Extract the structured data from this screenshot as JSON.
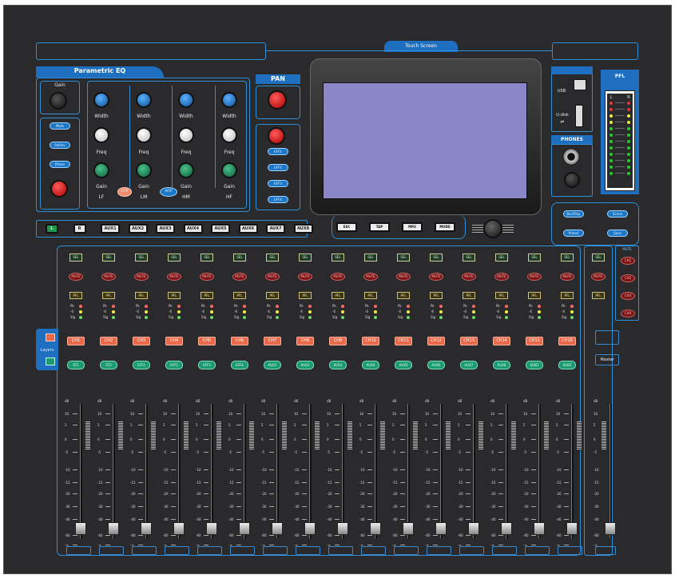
{
  "touch_screen_label": "Touch Screen",
  "eq": {
    "title": "Parametric EQ",
    "gain_label": "Gain",
    "side_buttons": [
      "Mute",
      "Pol/Inv",
      "Phase"
    ],
    "bands": [
      {
        "width": "Width",
        "freq": "Freq",
        "gain": "Gain",
        "name": "LF"
      },
      {
        "width": "Width",
        "freq": "Freq",
        "gain": "Gain",
        "name": "LM"
      },
      {
        "width": "Width",
        "freq": "Freq",
        "gain": "Gain",
        "name": "HM"
      },
      {
        "width": "Width",
        "freq": "Freq",
        "gain": "Gain",
        "name": "HF"
      }
    ],
    "lf_button": "LF/P",
    "hm_button": "HF/P"
  },
  "pan": {
    "title": "PAN",
    "fx_buttons": [
      "EFF1",
      "EFF2",
      "EFF3",
      "EFF4"
    ]
  },
  "usb": {
    "usb_label": "USB",
    "udisk_label": "U-disk"
  },
  "phones_label": "PHONES",
  "pfl_meter": {
    "title": "PFL",
    "left": "L",
    "right": "R"
  },
  "right_buttons": [
    "Rec/Play",
    "Scene",
    "Preset",
    "Save"
  ],
  "bus_row": [
    "L",
    "R",
    "AUX1",
    "AUX2",
    "AUX3",
    "AUX4",
    "AUX5",
    "AUX6",
    "AUX7",
    "AUX8"
  ],
  "nav_buttons": [
    "ESC",
    "TAP",
    "MP3",
    "MODE"
  ],
  "strip": {
    "sel": "SEL",
    "mute": "MUTE",
    "pfl": "PFL",
    "meter_labels": [
      "Pk",
      "-6",
      "Sig"
    ],
    "channels": [
      "CH1",
      "CH2",
      "CH3",
      "CH4",
      "CH5",
      "CH6",
      "CH7",
      "CH8",
      "CH9",
      "CH10",
      "CH11",
      "CH12",
      "CH13",
      "CH14",
      "CH15",
      "CH16"
    ],
    "layer2": [
      "ST1",
      "ST2",
      "EFF1",
      "EFF2",
      "EFF3",
      "EFF4",
      "AUX1",
      "AUX2",
      "AUX3",
      "AUX4",
      "AUX5",
      "AUX6",
      "AUX7",
      "AUX8",
      "SUB1",
      "SUB2"
    ],
    "scale": [
      "dB",
      "10",
      "5",
      "0",
      "-5",
      "-10",
      "-15",
      "-20",
      "-30",
      "-40",
      "-60",
      "-∞"
    ]
  },
  "layers_label": "Layers",
  "mute_groups": {
    "title": "MUTE",
    "items": [
      "CH1",
      "CH2",
      "CH3",
      "CH4"
    ]
  },
  "master_label": "Master",
  "colors": {
    "accent": "#2f8fd8",
    "panel": "#2a2a2c",
    "screen": "#8a86c8"
  }
}
